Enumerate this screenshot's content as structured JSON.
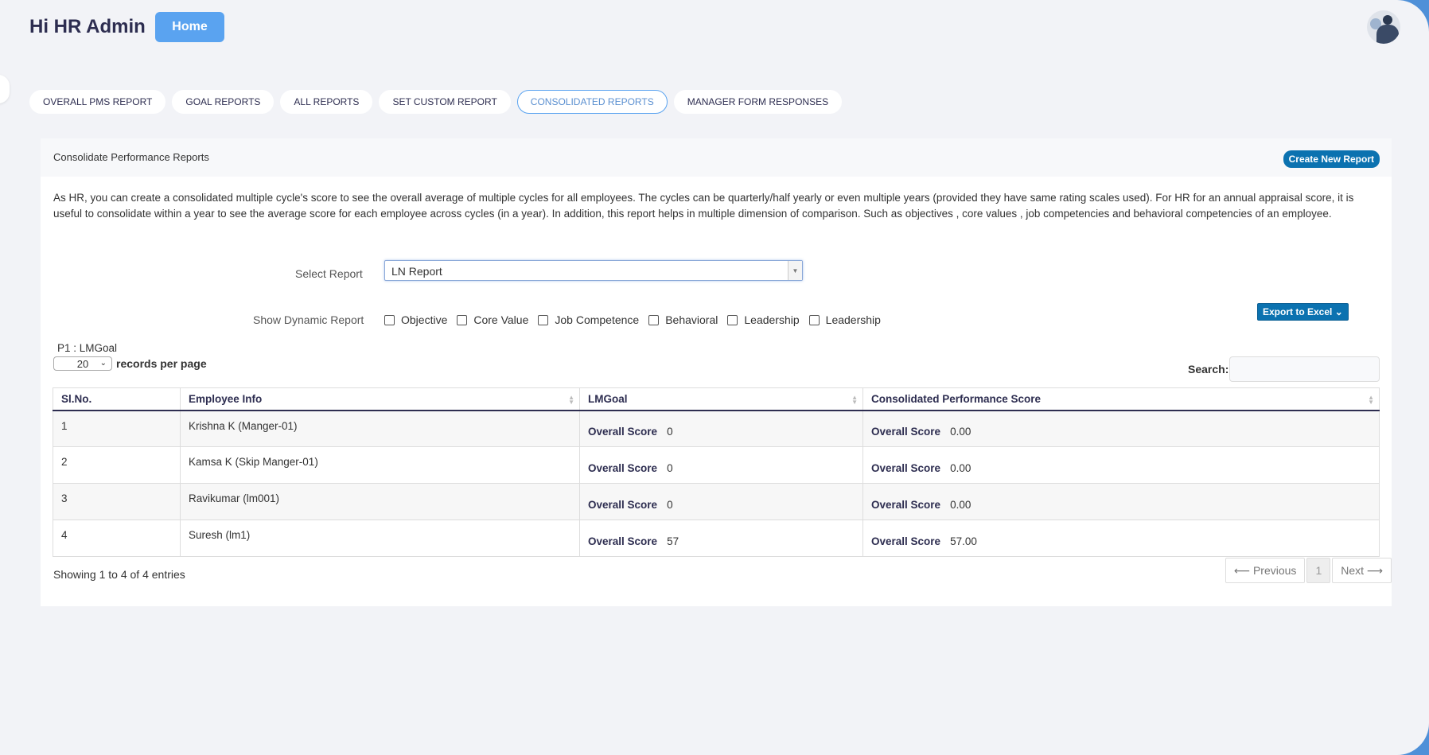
{
  "header": {
    "greeting": "Hi HR Admin",
    "home_label": "Home"
  },
  "tabs": [
    {
      "label": "OVERALL PMS REPORT",
      "active": false
    },
    {
      "label": "GOAL REPORTS",
      "active": false
    },
    {
      "label": "ALL REPORTS",
      "active": false
    },
    {
      "label": "SET CUSTOM REPORT",
      "active": false
    },
    {
      "label": "CONSOLIDATED REPORTS",
      "active": true
    },
    {
      "label": "MANAGER FORM RESPONSES",
      "active": false
    }
  ],
  "panel": {
    "title": "Consolidate Performance Reports",
    "create_label": "Create New Report",
    "description": "As HR, you can create a consolidated multiple cycle's score to see the overall average of multiple cycles for all employees. The cycles can be quarterly/half yearly or even multiple years (provided they have same rating scales used). For HR for an annual appraisal score, it is useful to consolidate within a year to see the average score for each employee across cycles (in a year). In addition, this report helps in multiple dimension of comparison. Such as objectives , core values , job competencies and behavioral competencies of an employee.",
    "select_label": "Select Report",
    "select_value": "LN Report",
    "dynamic_label": "Show Dynamic Report",
    "checkboxes": [
      "Objective",
      "Core Value",
      "Job Competence",
      "Behavioral",
      "Leadership",
      "Leadership"
    ],
    "export_label": "Export to Excel",
    "p1_label": "P1 : LMGoal",
    "records_value": "20",
    "records_text": "records per page",
    "search_label": "Search:"
  },
  "table": {
    "headers": [
      "Sl.No.",
      "Employee Info",
      "LMGoal",
      "Consolidated Performance Score"
    ],
    "score_label": "Overall Score",
    "rows": [
      {
        "sl": "1",
        "employee": "Krishna K (Manger-01)",
        "lmgoal": "0",
        "consolidated": "0.00"
      },
      {
        "sl": "2",
        "employee": "Kamsa K (Skip Manger-01)",
        "lmgoal": "0",
        "consolidated": "0.00"
      },
      {
        "sl": "3",
        "employee": "Ravikumar (lm001)",
        "lmgoal": "0",
        "consolidated": "0.00"
      },
      {
        "sl": "4",
        "employee": "Suresh (lm1)",
        "lmgoal": "57",
        "consolidated": "57.00"
      }
    ]
  },
  "footer": {
    "info": "Showing 1 to 4 of 4 entries",
    "prev": "⟵ Previous",
    "page": "1",
    "next": "Next ⟶"
  }
}
